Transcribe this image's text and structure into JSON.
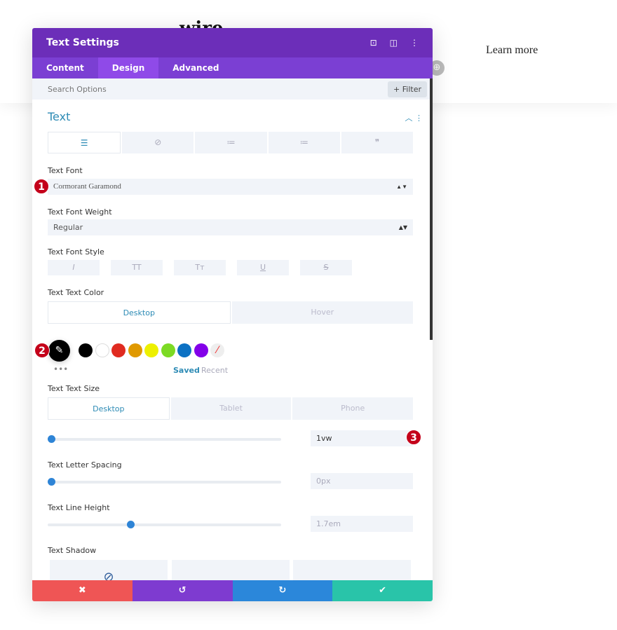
{
  "page": {
    "logo": "wire",
    "learn_more": "Learn more"
  },
  "panel": {
    "title": "Text Settings",
    "tabs": [
      "Content",
      "Design",
      "Advanced"
    ],
    "search_placeholder": "Search Options",
    "filter": "+ Filter",
    "section": "Text",
    "text_font": {
      "label": "Text Font",
      "value": "Cormorant Garamond"
    },
    "font_weight": {
      "label": "Text Font Weight",
      "value": "Regular"
    },
    "font_style": {
      "label": "Text Font Style",
      "buttons": [
        "I",
        "TT",
        "Tт",
        "U",
        "S"
      ]
    },
    "text_color": {
      "label": "Text Text Color",
      "tabs": [
        "Desktop",
        "Hover"
      ],
      "swatches": [
        "#000000",
        "#ffffff",
        "#e02b20",
        "#e09900",
        "#edf000",
        "#7cda24",
        "#0c71c3",
        "#8300e9"
      ],
      "saved": "Saved",
      "recent": "Recent"
    },
    "text_size": {
      "label": "Text Text Size",
      "tabs": [
        "Desktop",
        "Tablet",
        "Phone"
      ],
      "value": "1vw",
      "slider_fraction": 0.0
    },
    "letter_spacing": {
      "label": "Text Letter Spacing",
      "value": "0px",
      "slider_fraction": 0.0
    },
    "line_height": {
      "label": "Text Line Height",
      "value": "1.7em",
      "slider_fraction": 0.35
    },
    "text_shadow": {
      "label": "Text Shadow"
    }
  },
  "badges": [
    "1",
    "2",
    "3"
  ],
  "colors": {
    "header": "#6c2eb9",
    "tabs": "#7b3fd3",
    "cancel": "#ef5555",
    "undo": "#7e3bd0",
    "redo": "#2b87da",
    "save": "#29c4a9"
  }
}
